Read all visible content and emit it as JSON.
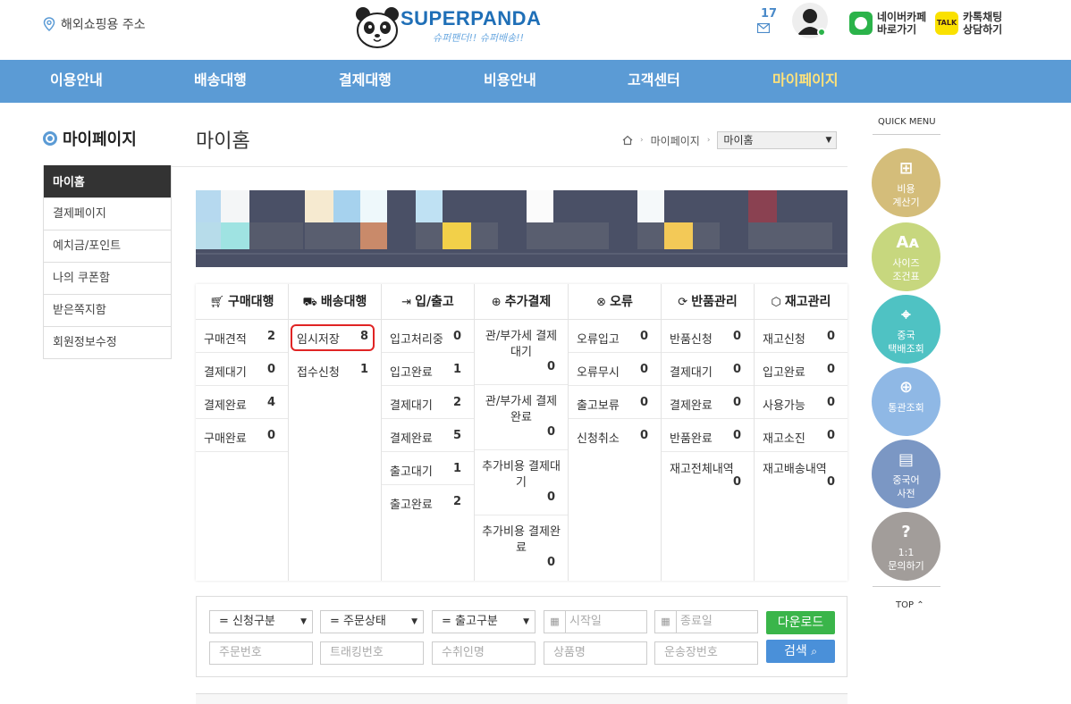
{
  "header": {
    "address_link": "해외쇼핑용 주소",
    "logo_text": "SUPERPANDA",
    "logo_slogan": "슈퍼팬더!! 슈퍼배송!!",
    "mail_count": "17",
    "naver_cafe": [
      "네이버카페",
      "바로가기"
    ],
    "kakao_talk_icon": "TALK",
    "kakao_chat": [
      "카톡채팅",
      "상담하기"
    ]
  },
  "nav": {
    "items": [
      "이용안내",
      "배송대행",
      "결제대행",
      "비용안내",
      "고객센터",
      "마이페이지"
    ]
  },
  "sidebar": {
    "title": "마이페이지",
    "items": [
      "마이홈",
      "결제페이지",
      "예치금/포인트",
      "나의 쿠폰함",
      "받은쪽지함",
      "회원정보수정"
    ]
  },
  "main": {
    "title": "마이홈",
    "breadcrumb": [
      "마이페이지",
      "마이홈"
    ]
  },
  "status": {
    "columns": [
      {
        "title": "구매대행",
        "rows": [
          [
            "구매견적",
            "2"
          ],
          [
            "결제대기",
            "0"
          ],
          [
            "결제완료",
            "4"
          ],
          [
            "구매완료",
            "0"
          ]
        ]
      },
      {
        "title": "배송대행",
        "rows": [
          [
            "임시저장",
            "8"
          ],
          [
            "접수신청",
            "1"
          ]
        ]
      },
      {
        "title": "입/출고",
        "rows": [
          [
            "입고처리중",
            "0"
          ],
          [
            "입고완료",
            "1"
          ],
          [
            "결제대기",
            "2"
          ],
          [
            "결제완료",
            "5"
          ],
          [
            "출고대기",
            "1"
          ],
          [
            "출고완료",
            "2"
          ]
        ]
      },
      {
        "title": "추가결제",
        "rows": [
          [
            "관/부가세 결제대기",
            "0"
          ],
          [
            "관/부가세 결제완료",
            "0"
          ],
          [
            "추가비용 결제대기",
            "0"
          ],
          [
            "추가비용 결제완료",
            "0"
          ]
        ]
      },
      {
        "title": "오류",
        "rows": [
          [
            "오류입고",
            "0"
          ],
          [
            "오류무시",
            "0"
          ],
          [
            "출고보류",
            "0"
          ],
          [
            "신청취소",
            "0"
          ]
        ]
      },
      {
        "title": "반품관리",
        "rows": [
          [
            "반품신청",
            "0"
          ],
          [
            "결제대기",
            "0"
          ],
          [
            "결제완료",
            "0"
          ],
          [
            "반품완료",
            "0"
          ],
          [
            "재고전체내역",
            "0"
          ]
        ]
      },
      {
        "title": "재고관리",
        "rows": [
          [
            "재고신청",
            "0"
          ],
          [
            "입고완료",
            "0"
          ],
          [
            "사용가능",
            "0"
          ],
          [
            "재고소진",
            "0"
          ],
          [
            "재고배송내역",
            "0"
          ]
        ]
      }
    ]
  },
  "search": {
    "selects": [
      "= 신청구분",
      "= 주문상태",
      "= 출고구분"
    ],
    "start_date_placeholder": "시작일",
    "end_date_placeholder": "종료일",
    "inputs": [
      "주문번호",
      "트래킹번호",
      "수취인명",
      "상품명",
      "운송장번호"
    ],
    "download_label": "다운로드",
    "search_label": "검색"
  },
  "quick_menu": {
    "title": "QUICK MENU",
    "items": [
      {
        "label": [
          "비용",
          "계산기"
        ],
        "color": "#d4bd7a"
      },
      {
        "label": [
          "사이즈",
          "조건표"
        ],
        "color": "#c7d77e"
      },
      {
        "label": [
          "중국",
          "택배조회"
        ],
        "color": "#4fc2c3"
      },
      {
        "label": [
          "통관조회"
        ],
        "color": "#8fb8e5"
      },
      {
        "label": [
          "중국어",
          "사전"
        ],
        "color": "#7b97c4"
      },
      {
        "label": [
          "1:1",
          "문의하기"
        ],
        "color": "#a29d9a"
      }
    ],
    "top_label": "TOP"
  },
  "colors": {
    "nav_bg": "#5b9bd5",
    "nav_active": "#ffe27a",
    "highlight_box": "#e02424"
  }
}
